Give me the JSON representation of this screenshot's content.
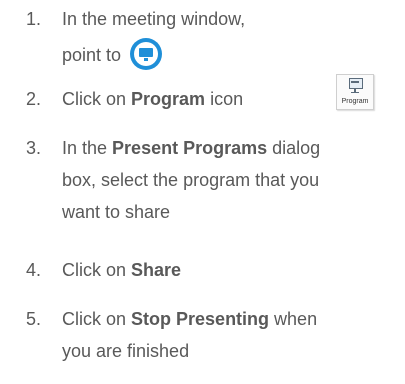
{
  "steps": [
    {
      "number": "1.",
      "lines": [
        "In the meeting window,",
        "point to"
      ],
      "icon": "present-screen-icon"
    },
    {
      "number": "2.",
      "pre": "Click on ",
      "bold": "Program",
      "post": " icon"
    },
    {
      "number": "3.",
      "pre": "In the ",
      "bold": "Present Programs",
      "post": " dialog",
      "lines": [
        "box, select the program that you",
        "want to share"
      ]
    },
    {
      "number": "4.",
      "pre": "Click on ",
      "bold": "Share"
    },
    {
      "number": "5.",
      "pre": "Click on ",
      "bold": "Stop Presenting",
      "post": " when",
      "lines": [
        "you are finished"
      ]
    }
  ],
  "program_button": {
    "caption": "Program",
    "icon": "program-window-icon"
  },
  "colors": {
    "text": "#595959",
    "accent": "#1f8fd8"
  }
}
